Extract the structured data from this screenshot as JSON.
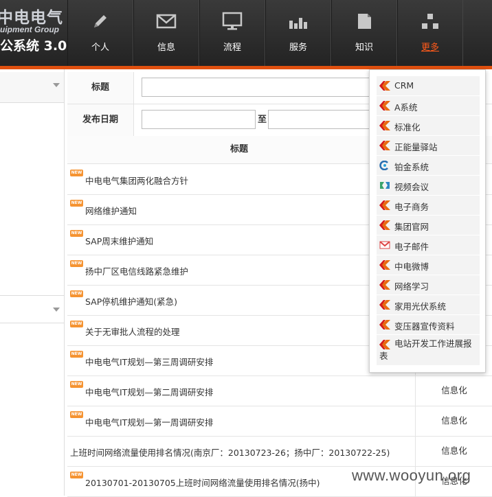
{
  "header": {
    "logo_cn": "中电电气",
    "logo_en": "uipment Group",
    "system_title": "公系统 3.0",
    "nav": [
      {
        "label": "个人",
        "icon": "pencil-icon"
      },
      {
        "label": "信息",
        "icon": "envelope-icon"
      },
      {
        "label": "流程",
        "icon": "monitor-icon"
      },
      {
        "label": "服务",
        "icon": "bar-chart-icon"
      },
      {
        "label": "知识",
        "icon": "document-icon"
      },
      {
        "label": "更多",
        "icon": "blocks-icon",
        "active": true
      }
    ],
    "accent_color": "#e0500f"
  },
  "search": {
    "title_label": "标题",
    "title_value": "",
    "date_label": "发布日期",
    "date_from": "",
    "date_sep": "至",
    "date_to": ""
  },
  "table": {
    "header_title": "标题",
    "rows": [
      {
        "title": "中电电气集团两化融合方针",
        "new": true,
        "category": ""
      },
      {
        "title": "网络维护通知",
        "new": true,
        "category": ""
      },
      {
        "title": "SAP周末维护通知",
        "new": true,
        "category": ""
      },
      {
        "title": "扬中厂区电信线路紧急维护",
        "new": true,
        "category": ""
      },
      {
        "title": "SAP停机维护通知(紧急)",
        "new": true,
        "category": ""
      },
      {
        "title": "关于无审批人流程的处理",
        "new": true,
        "category": ""
      },
      {
        "title": "中电电气IT规划—第三周调研安排",
        "new": true,
        "category": ""
      },
      {
        "title": "中电电气IT规划—第二周调研安排",
        "new": true,
        "category": "信息化"
      },
      {
        "title": "中电电气IT规划—第一周调研安排",
        "new": true,
        "category": "信息化"
      },
      {
        "title": "上班时间网络流量使用排名情况(南京厂：20130723-26；扬中厂：20130722-25)",
        "new": false,
        "category": "信息化"
      },
      {
        "title": "20130701-20130705上班时间网络流量使用排名情况(扬中)",
        "new": true,
        "category": "信息化"
      }
    ],
    "new_badge": "NEW"
  },
  "more_menu": {
    "items": [
      {
        "label": "CRM",
        "icon": "orange-chevron-icon"
      },
      {
        "label": "A系统",
        "icon": "orange-chevron-icon"
      },
      {
        "label": "标准化",
        "icon": "orange-chevron-icon"
      },
      {
        "label": "正能量驿站",
        "icon": "orange-chevron-icon"
      },
      {
        "label": "铂金系统",
        "icon": "blue-swirl-icon"
      },
      {
        "label": "视频会议",
        "icon": "video-conference-icon"
      },
      {
        "label": "电子商务",
        "icon": "orange-chevron-icon"
      },
      {
        "label": "集团官网",
        "icon": "orange-chevron-icon"
      },
      {
        "label": "电子邮件",
        "icon": "gmail-icon"
      },
      {
        "label": "中电微博",
        "icon": "orange-chevron-icon"
      },
      {
        "label": "网络学习",
        "icon": "orange-chevron-icon"
      },
      {
        "label": "家用光伏系统",
        "icon": "orange-chevron-icon"
      },
      {
        "label": "变压器宣传资料",
        "icon": "orange-chevron-icon"
      },
      {
        "label": "电站开发工作进展报表",
        "icon": "orange-chevron-icon"
      }
    ]
  },
  "watermark": "www.wooyun.org"
}
